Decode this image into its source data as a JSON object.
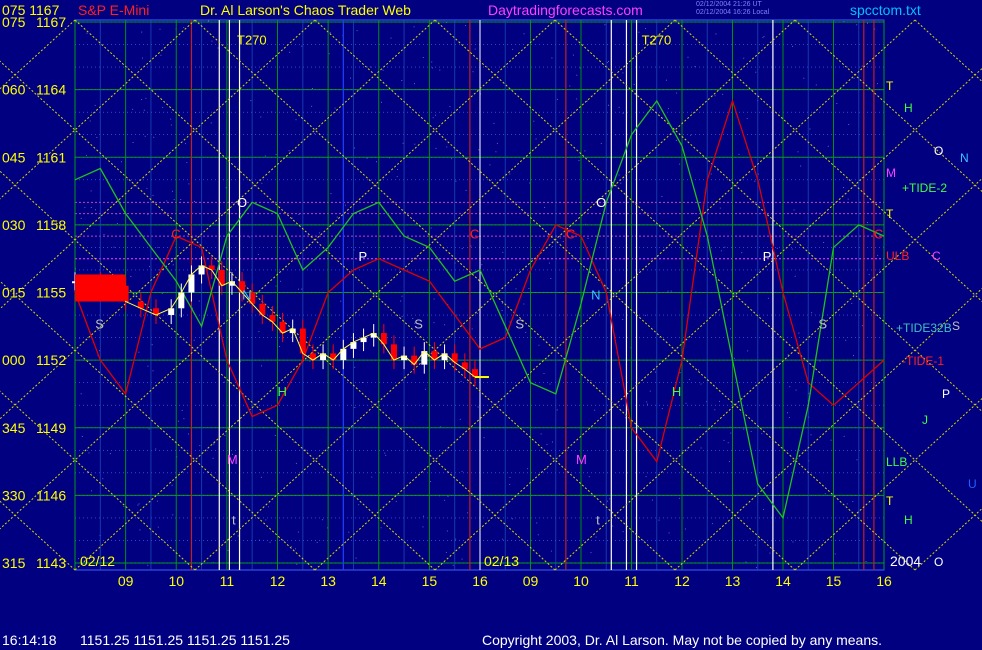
{
  "header": {
    "top_price_deg": "075",
    "top_price": "1167",
    "symbol": "S&P E-Mini",
    "title": "Dr. Al Larson's Chaos Trader Web",
    "site": "Daytradingforecasts.com",
    "stamp_line1": "02/12/2004 21:26 UT",
    "stamp_line2": "02/12/2004 16:26 Local",
    "file": "spcctom.txt"
  },
  "footer": {
    "time": "16:14:18",
    "quote": "1151.25 1151.25 1151.25 1151.25",
    "copyright": "Copyright 2003, Dr. Al Larson. May not be copied by any means."
  },
  "colors": {
    "background": "#000080",
    "header_symbol": "#ff2020",
    "header_title": "#ffff00",
    "header_site": "#ff40ff",
    "header_file": "#00c0ff",
    "axis_label": "#ffff00",
    "grid": "#00a000",
    "diag": "#d8d800",
    "green_curve": "#20c020",
    "red_curve": "#e00000",
    "candle_red": "#ff0000",
    "candle_white": "#ffffff"
  },
  "chart_data": {
    "type": "line",
    "title": "S&P E-Mini",
    "xlabel": "",
    "ylabel": "",
    "ylim": [
      1143,
      1167
    ],
    "grid": true,
    "y_ticks": [
      {
        "deg": "075",
        "price": 1167
      },
      {
        "deg": "060",
        "price": 1164
      },
      {
        "deg": "045",
        "price": 1161
      },
      {
        "deg": "030",
        "price": 1158
      },
      {
        "deg": "015",
        "price": 1155
      },
      {
        "deg": "000",
        "price": 1152
      },
      {
        "deg": "345",
        "price": 1149
      },
      {
        "deg": "330",
        "price": 1146
      },
      {
        "deg": "315",
        "price": 1143
      }
    ],
    "panels": [
      {
        "date": "02/12",
        "hours": [
          "09",
          "10",
          "11",
          "12",
          "13",
          "14",
          "15",
          "16"
        ],
        "x_start": 8.0,
        "x_end": 16.0
      },
      {
        "date": "02/13",
        "hours": [
          "09",
          "10",
          "11",
          "12",
          "13",
          "14",
          "15",
          "16"
        ],
        "x_start": 8.0,
        "x_end": 16.0
      }
    ],
    "year_label": "2004",
    "last_price": 1151.25,
    "price_series": {
      "name": "",
      "x": [
        8.0,
        8.5,
        9.0,
        9.3,
        9.6,
        9.9,
        10.1,
        10.3,
        10.5,
        10.7,
        10.9,
        11.1,
        11.3,
        11.5,
        11.7,
        11.9,
        12.1,
        12.3,
        12.5,
        12.7,
        12.9,
        13.1,
        13.3,
        13.5,
        13.7,
        13.9,
        14.1,
        14.3,
        14.5,
        14.7,
        14.9,
        15.1,
        15.3,
        15.5,
        15.7,
        15.9
      ],
      "y": [
        1155.5,
        1155.3,
        1154.6,
        1154.3,
        1154.0,
        1154.3,
        1155.0,
        1155.8,
        1156.2,
        1156.0,
        1155.3,
        1155.5,
        1155.0,
        1154.5,
        1154.0,
        1153.7,
        1153.2,
        1153.4,
        1152.3,
        1152.0,
        1152.3,
        1152.0,
        1152.5,
        1152.8,
        1153.0,
        1153.2,
        1152.7,
        1152.0,
        1152.2,
        1151.8,
        1152.4,
        1152.0,
        1152.3,
        1151.9,
        1151.6,
        1151.25
      ]
    },
    "green_curve": {
      "x": [
        8.0,
        8.5,
        9.0,
        9.5,
        10.0,
        10.5,
        11.0,
        11.5,
        12.0,
        12.5,
        13.0,
        13.5,
        14.0,
        14.5,
        15.0,
        15.5,
        16.0,
        16.5,
        17.0,
        17.5,
        18.0,
        18.5,
        19.0,
        19.5,
        20.0,
        20.5,
        21.0,
        21.5,
        22.0,
        22.5,
        23.0,
        23.5,
        24.0
      ],
      "y": [
        1160.0,
        1160.5,
        1158.5,
        1157.0,
        1155.5,
        1153.5,
        1157.5,
        1159.0,
        1158.5,
        1156.0,
        1157.0,
        1158.5,
        1159.0,
        1157.5,
        1157.0,
        1155.5,
        1156.0,
        1153.5,
        1151.0,
        1150.5,
        1154.5,
        1159.0,
        1162.0,
        1163.5,
        1161.5,
        1157.5,
        1152.0,
        1146.5,
        1145.0,
        1150.0,
        1157.0,
        1158.0,
        1157.5
      ]
    },
    "red_curve": {
      "x": [
        8.0,
        8.5,
        9.0,
        9.5,
        10.0,
        10.5,
        11.0,
        11.5,
        12.0,
        12.5,
        13.0,
        13.5,
        14.0,
        14.5,
        15.0,
        15.5,
        16.0,
        16.5,
        17.0,
        17.5,
        18.0,
        18.5,
        19.0,
        19.5,
        20.0,
        20.5,
        21.0,
        21.5,
        22.0,
        22.5,
        23.0,
        23.5,
        24.0
      ],
      "y": [
        1155.0,
        1152.0,
        1150.5,
        1155.0,
        1157.5,
        1157.0,
        1152.0,
        1149.5,
        1150.0,
        1152.0,
        1155.0,
        1156.0,
        1156.5,
        1156.0,
        1155.5,
        1154.0,
        1152.5,
        1153.0,
        1156.0,
        1158.0,
        1157.5,
        1155.0,
        1149.0,
        1147.5,
        1152.0,
        1160.0,
        1163.5,
        1160.0,
        1155.0,
        1151.0,
        1150.0,
        1151.0,
        1152.0
      ]
    },
    "marker_labels": [
      "T270",
      "T270",
      "O",
      "O",
      "C",
      "C",
      "C",
      "C",
      "P",
      "P",
      "N",
      "N",
      "S",
      "S",
      "S",
      "S",
      "S",
      "H",
      "H",
      "M",
      "M",
      "U",
      "U",
      "J",
      "t",
      "t"
    ],
    "right_labels": [
      "T",
      "H",
      "M",
      "+TIDE-2",
      "T",
      "ULB",
      "C",
      "+TIDE32B",
      "-TIDE-1",
      "LLB",
      "T",
      "H",
      "J",
      "P",
      "N",
      "O",
      "U",
      "S",
      "O"
    ]
  }
}
